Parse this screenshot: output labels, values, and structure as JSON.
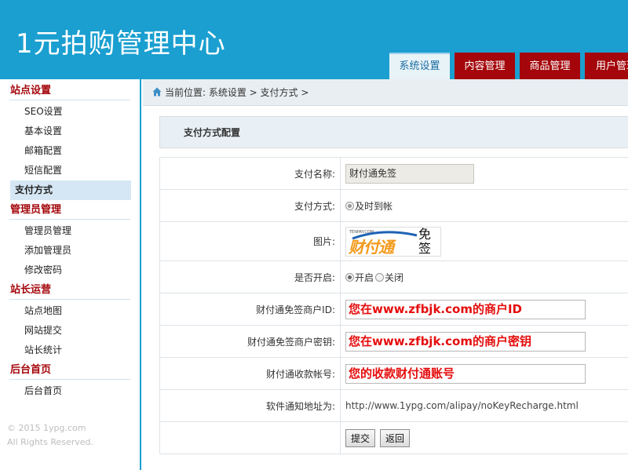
{
  "app": {
    "title": "1元拍购管理中心"
  },
  "tabs": [
    {
      "label": "系统设置",
      "active": true
    },
    {
      "label": "内容管理",
      "active": false
    },
    {
      "label": "商品管理",
      "active": false
    },
    {
      "label": "用户管理",
      "active": false
    }
  ],
  "sidebar": {
    "sections": [
      {
        "title": "站点设置",
        "items": [
          "SEO设置",
          "基本设置",
          "邮箱配置",
          "短信配置",
          "支付方式"
        ]
      },
      {
        "title": "管理员管理",
        "items": [
          "管理员管理",
          "添加管理员",
          "修改密码"
        ]
      },
      {
        "title": "站长运营",
        "items": [
          "站点地图",
          "网站提交",
          "站长统计"
        ]
      },
      {
        "title": "后台首页",
        "items": [
          "后台首页"
        ]
      }
    ],
    "active_item": "支付方式",
    "copyright_line1": "© 2015 1ypg.com",
    "copyright_line2": "All Rights Reserved."
  },
  "breadcrumb": {
    "text": "当前位置: 系统设置 > 支付方式 >"
  },
  "panel": {
    "title": "支付方式配置"
  },
  "form": {
    "pay_name_label": "支付名称:",
    "pay_name_value": "财付通免签",
    "pay_method_label": "支付方式:",
    "pay_method_option": "及时到帐",
    "image_label": "图片:",
    "image_logo_small": "TENPAY.COM",
    "image_logo_main": "财付通",
    "image_logo_side": "免签",
    "enabled_label": "是否开启:",
    "enabled_on": "开启",
    "enabled_off": "关闭",
    "merchant_id_label": "财付通免签商户ID:",
    "merchant_id_value": "您在www.zfbjk.com的商户ID",
    "merchant_key_label": "财付通免签商户密钥:",
    "merchant_key_value": "您在www.zfbjk.com的商户密钥",
    "account_label": "财付通收款帐号:",
    "account_value": "您的收款财付通账号",
    "notify_label": "软件通知地址为:",
    "notify_value": "http://www.1ypg.com/alipay/noKeyRecharge.html",
    "submit_label": "提交",
    "back_label": "返回"
  },
  "colors": {
    "header_bg": "#1a9fd0",
    "tab_bg": "#a4060b",
    "section_title": "#a4060b",
    "red_text": "#e50d0d"
  }
}
